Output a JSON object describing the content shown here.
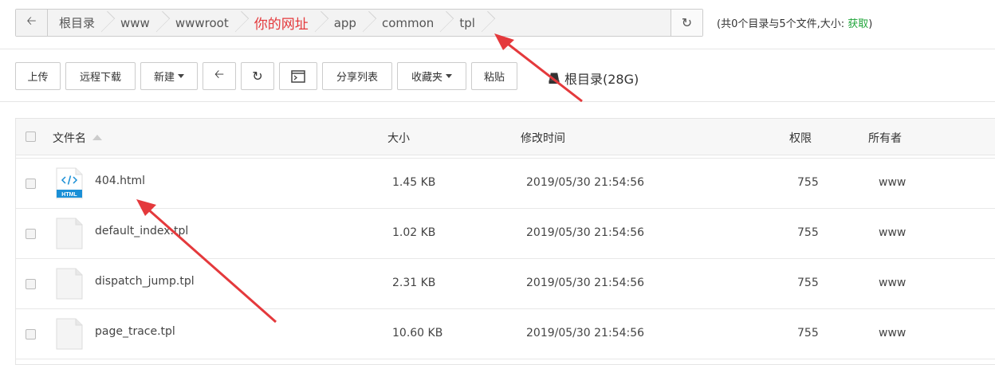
{
  "breadcrumb": {
    "items": [
      "根目录",
      "www",
      "wwwroot",
      "你的网址",
      "app",
      "common",
      "tpl"
    ],
    "highlight_index": 3
  },
  "info": {
    "prefix": "(共0个目录与5个文件,大小: ",
    "link": "获取",
    "suffix": ")"
  },
  "toolbar": {
    "upload": "上传",
    "remote_download": "远程下载",
    "new": "新建",
    "share_list": "分享列表",
    "favorites": "收藏夹",
    "paste": "粘贴",
    "disk_label": "根目录(28G)"
  },
  "table": {
    "headers": {
      "name": "文件名",
      "size": "大小",
      "mtime": "修改时间",
      "perm": "权限",
      "owner": "所有者"
    },
    "rows": [
      {
        "name": "404.html",
        "size": "1.45 KB",
        "mtime": "2019/05/30 21:54:56",
        "perm": "755",
        "owner": "www",
        "icon": "html-file-icon"
      },
      {
        "name": "default_index.tpl",
        "size": "1.02 KB",
        "mtime": "2019/05/30 21:54:56",
        "perm": "755",
        "owner": "www",
        "icon": "file-icon"
      },
      {
        "name": "dispatch_jump.tpl",
        "size": "2.31 KB",
        "mtime": "2019/05/30 21:54:56",
        "perm": "755",
        "owner": "www",
        "icon": "file-icon"
      },
      {
        "name": "page_trace.tpl",
        "size": "10.60 KB",
        "mtime": "2019/05/30 21:54:56",
        "perm": "755",
        "owner": "www",
        "icon": "file-icon"
      }
    ]
  },
  "colors": {
    "accent_red": "#e4393c",
    "link_green": "#20a53a",
    "html_blue": "#1a8fd6"
  }
}
